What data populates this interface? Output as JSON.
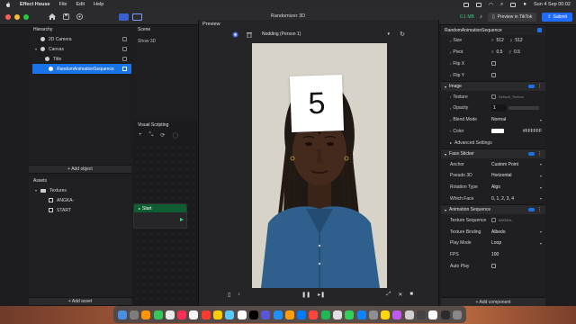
{
  "menubar": {
    "app_name": "Effect House",
    "menus": [
      "File",
      "Edit",
      "Help"
    ],
    "clock": "Sun 4 Sep  00:02"
  },
  "toolbar": {
    "project_title": "Randomizer 3D",
    "memory": "0.1 MB",
    "preview_tiktok_label": "Preview in TikTok",
    "submit_label": "Submit",
    "traffic_colors": [
      "#ff5f57",
      "#febc2e",
      "#28c840"
    ]
  },
  "hierarchy": {
    "title": "Hierarchy",
    "items": [
      {
        "label": "2D Camera",
        "expander": ""
      },
      {
        "label": "Canvas",
        "expander": "▾"
      },
      {
        "label": "Title",
        "expander": ""
      },
      {
        "label": "RandomAnimationSequence",
        "expander": ""
      }
    ],
    "add_object_label": "+ Add object"
  },
  "assets": {
    "title": "Assets",
    "items": [
      {
        "label": "Textures",
        "expander": "▾"
      },
      {
        "label": "ANGKA-",
        "expander": ""
      },
      {
        "label": "START",
        "expander": ""
      }
    ],
    "add_asset_label": "+ Add asset"
  },
  "scene": {
    "title": "Scene",
    "label": "Show 3D"
  },
  "visual_scripting": {
    "title": "Visual Scripting",
    "tools": [
      "+",
      "⤡",
      "⟳",
      "◯"
    ],
    "start_node_label": "Start"
  },
  "preview": {
    "title": "Preview",
    "effect_dropdown": "Nodding (Person 1)",
    "card_number": "5"
  },
  "inspector": {
    "top_title": "RandomAnimationSequence",
    "transform_rows": [
      {
        "label": "Size",
        "x": "512",
        "y": "512"
      },
      {
        "label": "Pivot",
        "x": "0.5",
        "y": "0.5"
      }
    ],
    "flip_x_label": "Flip X",
    "flip_y_label": "Flip Y",
    "image_section": "Image",
    "texture_label": "Texture",
    "texture_value": "Default_Texture",
    "opacity_label": "Opacity",
    "opacity_value": "1",
    "blend_label": "Blend Mode",
    "blend_value": "Normal",
    "color_label": "Color",
    "color_value": "#FFFFFF",
    "advanced_label": "Advanced Settings",
    "face_sticker_section": "Face Sticker",
    "anchor_label": "Anchor",
    "anchor_value": "Custom Point",
    "pseudo_label": "Pseudo 3D",
    "pseudo_value": "Horizontal",
    "rotation_label": "Rotation Type",
    "rotation_value": "Algo",
    "which_face_label": "Which Face",
    "which_face_value": "0, 1, 2, 3, 4",
    "anim_section": "Animation Sequence",
    "tex_seq_label": "Texture Sequence",
    "tex_seq_value": "ANGKA-",
    "tex_bind_label": "Texture Binding",
    "tex_bind_value": "Albedo",
    "play_mode_label": "Play Mode",
    "play_mode_value": "Loop",
    "fps_label": "FPS",
    "fps_value": "100",
    "auto_play_label": "Auto Play",
    "add_component_label": "+ Add component"
  },
  "dock": {
    "app_colors": [
      "#4a90e2",
      "#7d7d7d",
      "#ff9500",
      "#34c759",
      "#e9e9e9",
      "#ff2d55",
      "#f5f5f5",
      "#ff3b30",
      "#ffcc00",
      "#5ac8fa",
      "#ffffff",
      "#000000",
      "#5856d6",
      "#1e90ff",
      "#ff9f0a",
      "#007aff",
      "#ff453a",
      "#1db954",
      "#e0e0e0",
      "#30d158",
      "#0a84ff",
      "#8e8e93",
      "#ffd60a",
      "#bf5af2",
      "#d0d0d0",
      "#444444",
      "#ffffff",
      "#2c2c2e",
      "#888888"
    ]
  }
}
